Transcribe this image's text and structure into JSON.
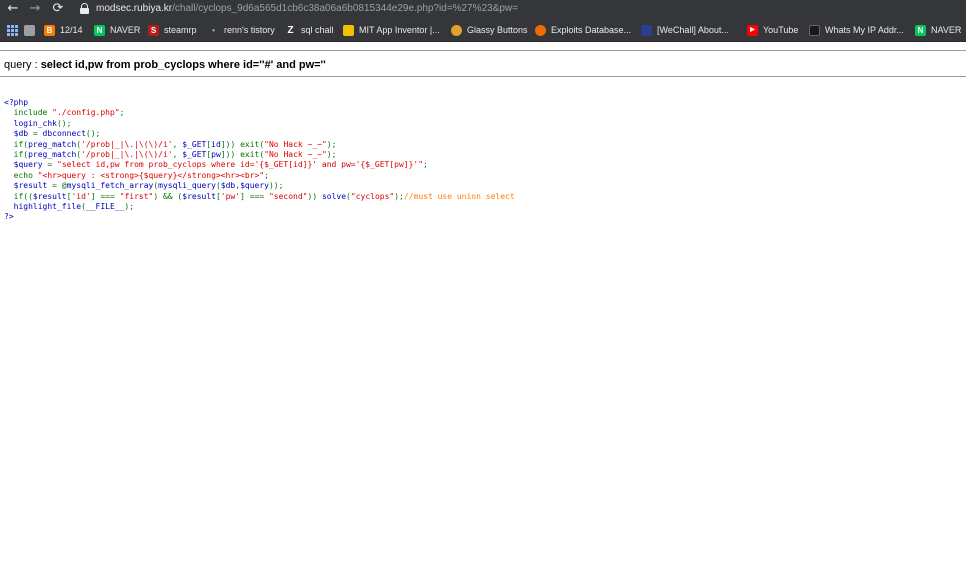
{
  "browser": {
    "url_host": "modsec.rubiya.kr",
    "url_path": "/chall/cyclops_9d6a565d1cb6c38a06a6b0815344e29e.php?id=%27%23&pw=",
    "bookmarks": [
      {
        "label": "",
        "icon": "apps-grid-icon"
      },
      {
        "label": "",
        "icon": "bookmark-folder-icon"
      },
      {
        "label": "12/14",
        "icon": "blogger-icon",
        "color": "#f57d00"
      },
      {
        "label": "NAVER",
        "icon": "naver-icon",
        "color": "#03c75a"
      },
      {
        "label": "steamrp",
        "icon": "steamrp-icon",
        "color": "#b71c1c"
      },
      {
        "label": "renn's tistory",
        "icon": "tistory-icon",
        "color": "#4a90e2"
      },
      {
        "label": "sql chall",
        "icon": "z-icon",
        "color": "#ffffff"
      },
      {
        "label": "MIT App Inventor |...",
        "icon": "mit-app-inventor-icon",
        "color": "#f2c200"
      },
      {
        "label": "Glassy Buttons",
        "icon": "glassy-buttons-icon",
        "color": "#e0a030"
      },
      {
        "label": "Exploits Database...",
        "icon": "exploit-db-icon",
        "color": "#ef6c00"
      },
      {
        "label": "[WeChall] About...",
        "icon": "wechall-icon",
        "color": "#2d3e8f"
      },
      {
        "label": "YouTube",
        "icon": "youtube-icon",
        "color": "#ff0000"
      },
      {
        "label": "Whats My IP Addr...",
        "icon": "ip-icon",
        "color": "#1a1a1a"
      },
      {
        "label": "NAVER",
        "icon": "naver-icon",
        "color": "#03c75a"
      }
    ]
  },
  "page": {
    "query_prefix": "query : ",
    "query_value": "select id,pw from prob_cyclops where id=''#' and pw=''",
    "code_lines": [
      [
        {
          "c": "def",
          "t": "<?php"
        }
      ],
      [
        {
          "c": "def",
          "t": "  "
        },
        {
          "c": "kw",
          "t": "include "
        },
        {
          "c": "str",
          "t": "\"./config.php\""
        },
        {
          "c": "kw",
          "t": ";"
        }
      ],
      [
        {
          "c": "def",
          "t": "  login_chk"
        },
        {
          "c": "kw",
          "t": "();"
        }
      ],
      [
        {
          "c": "def",
          "t": "  $db "
        },
        {
          "c": "kw",
          "t": "= "
        },
        {
          "c": "def",
          "t": "dbconnect"
        },
        {
          "c": "kw",
          "t": "();"
        }
      ],
      [
        {
          "c": "kw",
          "t": "  if("
        },
        {
          "c": "def",
          "t": "preg_match"
        },
        {
          "c": "kw",
          "t": "("
        },
        {
          "c": "str",
          "t": "'/prob|_|\\.|\\(\\)/i'"
        },
        {
          "c": "kw",
          "t": ", "
        },
        {
          "c": "def",
          "t": "$_GET"
        },
        {
          "c": "kw",
          "t": "["
        },
        {
          "c": "def",
          "t": "id"
        },
        {
          "c": "kw",
          "t": "])) exit("
        },
        {
          "c": "str",
          "t": "\"No Hack ~_~\""
        },
        {
          "c": "kw",
          "t": ");"
        }
      ],
      [
        {
          "c": "kw",
          "t": "  if("
        },
        {
          "c": "def",
          "t": "preg_match"
        },
        {
          "c": "kw",
          "t": "("
        },
        {
          "c": "str",
          "t": "'/prob|_|\\.|\\(\\)/i'"
        },
        {
          "c": "kw",
          "t": ", "
        },
        {
          "c": "def",
          "t": "$_GET"
        },
        {
          "c": "kw",
          "t": "["
        },
        {
          "c": "def",
          "t": "pw"
        },
        {
          "c": "kw",
          "t": "])) exit("
        },
        {
          "c": "str",
          "t": "\"No Hack ~_~\""
        },
        {
          "c": "kw",
          "t": ");"
        }
      ],
      [
        {
          "c": "def",
          "t": "  $query "
        },
        {
          "c": "kw",
          "t": "= "
        },
        {
          "c": "str",
          "t": "\"select id,pw from prob_cyclops where id='{$_GET[id]}' and pw='{$_GET[pw]}'\""
        },
        {
          "c": "kw",
          "t": ";"
        }
      ],
      [
        {
          "c": "kw",
          "t": "  echo "
        },
        {
          "c": "str",
          "t": "\"<hr>query : <strong>{$query}</strong><hr><br>\""
        },
        {
          "c": "kw",
          "t": ";"
        }
      ],
      [
        {
          "c": "def",
          "t": "  $result "
        },
        {
          "c": "kw",
          "t": "= @"
        },
        {
          "c": "def",
          "t": "mysqli_fetch_array"
        },
        {
          "c": "kw",
          "t": "("
        },
        {
          "c": "def",
          "t": "mysqli_query"
        },
        {
          "c": "kw",
          "t": "("
        },
        {
          "c": "def",
          "t": "$db"
        },
        {
          "c": "kw",
          "t": ","
        },
        {
          "c": "def",
          "t": "$query"
        },
        {
          "c": "kw",
          "t": "));"
        }
      ],
      [
        {
          "c": "kw",
          "t": "  if(("
        },
        {
          "c": "def",
          "t": "$result"
        },
        {
          "c": "kw",
          "t": "["
        },
        {
          "c": "str",
          "t": "'id'"
        },
        {
          "c": "kw",
          "t": "] === "
        },
        {
          "c": "str",
          "t": "\"first\""
        },
        {
          "c": "kw",
          "t": ") && ("
        },
        {
          "c": "def",
          "t": "$result"
        },
        {
          "c": "kw",
          "t": "["
        },
        {
          "c": "str",
          "t": "'pw'"
        },
        {
          "c": "kw",
          "t": "] === "
        },
        {
          "c": "str",
          "t": "\"second\""
        },
        {
          "c": "kw",
          "t": ")) "
        },
        {
          "c": "def",
          "t": "solve"
        },
        {
          "c": "kw",
          "t": "("
        },
        {
          "c": "str",
          "t": "\"cyclops\""
        },
        {
          "c": "kw",
          "t": ");"
        },
        {
          "c": "cmt",
          "t": "//must use union select"
        }
      ],
      [
        {
          "c": "def",
          "t": "  highlight_file"
        },
        {
          "c": "kw",
          "t": "("
        },
        {
          "c": "def",
          "t": "__FILE__"
        },
        {
          "c": "kw",
          "t": ");"
        }
      ],
      [
        {
          "c": "def",
          "t": "?>"
        }
      ]
    ]
  }
}
